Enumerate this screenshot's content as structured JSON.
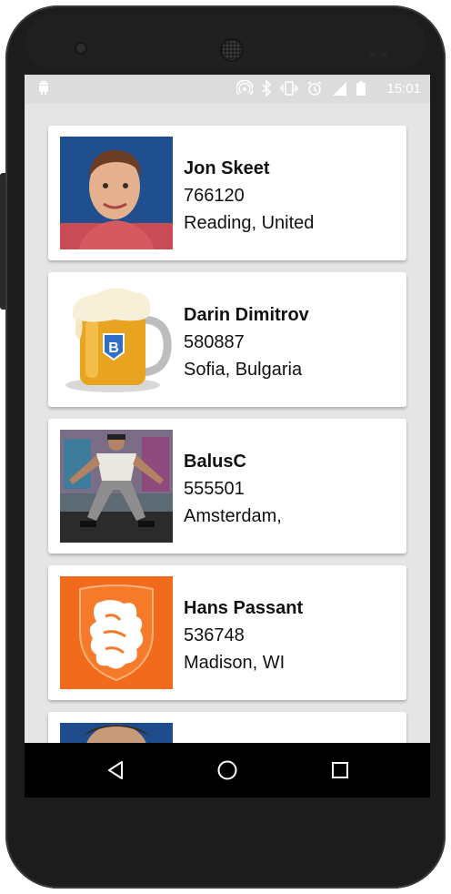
{
  "statusbar": {
    "time": "15:01",
    "icons": [
      "android-icon",
      "hotspot-icon",
      "bluetooth-icon",
      "vibrate-icon",
      "alarm-icon",
      "signal-icon",
      "battery-icon"
    ]
  },
  "users": [
    {
      "name": "Jon Skeet",
      "reputation": "766120",
      "location": "Reading, United"
    },
    {
      "name": "Darin Dimitrov",
      "reputation": "580887",
      "location": "Sofia, Bulgaria"
    },
    {
      "name": "BalusC",
      "reputation": "555501",
      "location": "Amsterdam,"
    },
    {
      "name": "Hans Passant",
      "reputation": "536748",
      "location": "Madison, WI"
    }
  ],
  "navbar": {
    "buttons": [
      "back-icon",
      "home-icon",
      "recents-icon"
    ]
  },
  "colors": {
    "screen_background": "#e5e5e5",
    "card_background": "#ffffff",
    "navbar": "#000000",
    "avatar4_orange": "#f26a1b"
  }
}
